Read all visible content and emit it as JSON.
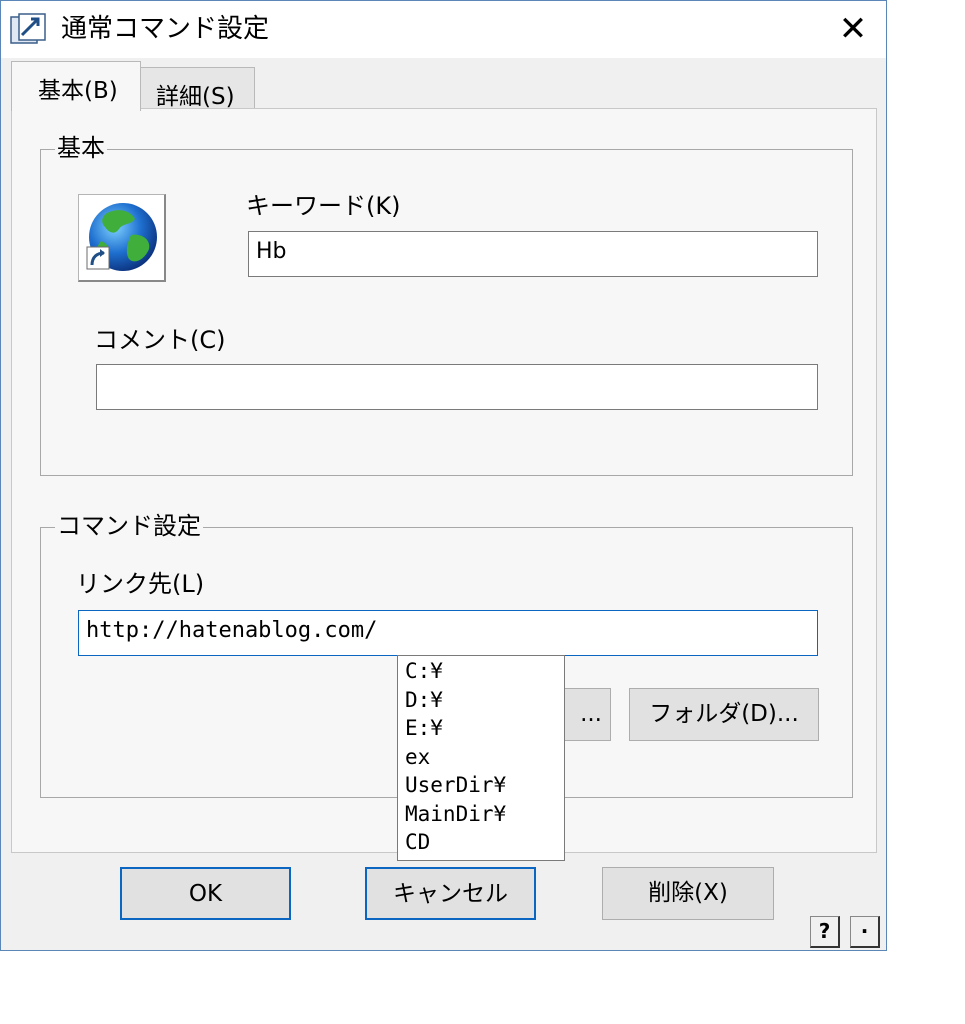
{
  "window": {
    "title": "通常コマンド設定",
    "close_label": "✕"
  },
  "tabs": [
    {
      "label": "基本(B)",
      "selected": true
    },
    {
      "label": "詳細(S)",
      "selected": false
    }
  ],
  "basic_group": {
    "legend": "基本",
    "icon": "globe-shortcut-icon",
    "keyword_label": "キーワード(K)",
    "keyword_value": "Hb",
    "comment_label": "コメント(C)",
    "comment_value": ""
  },
  "command_group": {
    "legend": "コマンド設定",
    "link_label": "リンク先(L)",
    "link_value": "http://hatenablog.com/",
    "file_button_partial": "...",
    "folder_button": "フォルダ(D)..."
  },
  "autocomplete": {
    "items": [
      "C:¥",
      "D:¥",
      "E:¥",
      "ex",
      "UserDir¥",
      "MainDir¥",
      "CD"
    ]
  },
  "footer": {
    "ok": "OK",
    "cancel": "キャンセル",
    "delete": "削除(X)",
    "help": "?",
    "dot": "·"
  },
  "colors": {
    "accent": "#0a66c0",
    "window_border": "#5a86b8",
    "face": "#f0f0f0"
  }
}
